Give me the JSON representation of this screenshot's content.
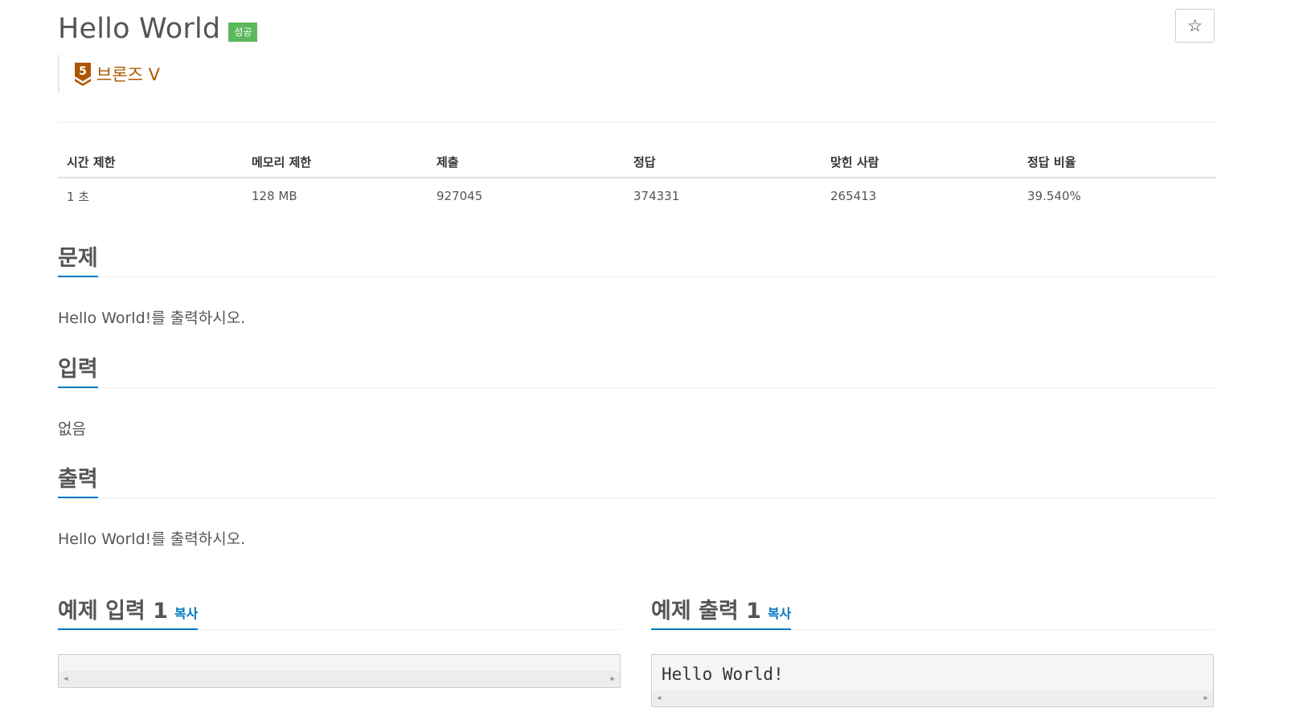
{
  "problem": {
    "title": "Hello World",
    "result_badge": "성공",
    "tier_number": "5",
    "tier_label": "브론즈 V",
    "star_icon": "☆"
  },
  "stats": {
    "headers": [
      "시간 제한",
      "메모리 제한",
      "제출",
      "정답",
      "맞힌 사람",
      "정답 비율"
    ],
    "values": [
      "1 초",
      "128 MB",
      "927045",
      "374331",
      "265413",
      "39.540%"
    ]
  },
  "sections": {
    "description": {
      "title": "문제",
      "body": "Hello World!를 출력하시오."
    },
    "input": {
      "title": "입력",
      "body": "없음"
    },
    "output": {
      "title": "출력",
      "body": "Hello World!를 출력하시오."
    }
  },
  "samples": {
    "input": {
      "title": "예제 입력 1",
      "copy_label": "복사",
      "content": ""
    },
    "output": {
      "title": "예제 출력 1",
      "copy_label": "복사",
      "content": "Hello World!"
    }
  },
  "colors": {
    "badge_success": "#5cb85c",
    "tier_bronze": "#ad5600",
    "accent_blue": "#0076c0"
  }
}
